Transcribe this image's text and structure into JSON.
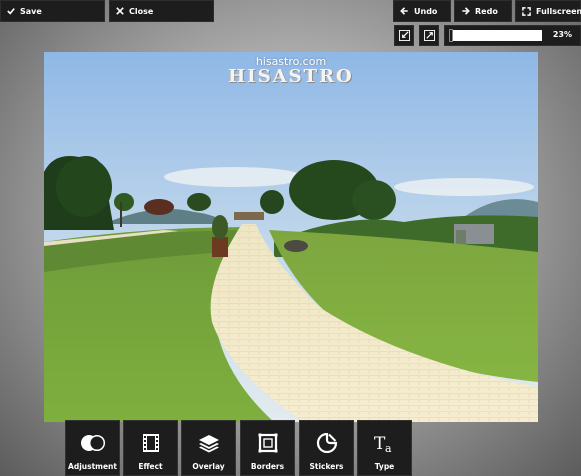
{
  "header": {
    "save_label": "Save",
    "close_label": "Close",
    "undo_label": "Undo",
    "redo_label": "Redo",
    "fullscreen_label": "Fullscreen"
  },
  "zoom": {
    "value_label": "23%",
    "level_fraction": 0.0
  },
  "photo": {
    "watermark_url": "hisastro.com",
    "watermark_logo": "HISASTRO"
  },
  "tools": [
    {
      "label": "Adjustment",
      "icon": "adjustment-icon"
    },
    {
      "label": "Effect",
      "icon": "film-strip-icon"
    },
    {
      "label": "Overlay",
      "icon": "layers-icon"
    },
    {
      "label": "Borders",
      "icon": "frame-icon"
    },
    {
      "label": "Stickers",
      "icon": "sticker-icon"
    },
    {
      "label": "Type",
      "icon": "text-type-icon"
    }
  ],
  "colors": {
    "toolbar_bg": "#1d1d1d",
    "text": "#ffffff"
  }
}
